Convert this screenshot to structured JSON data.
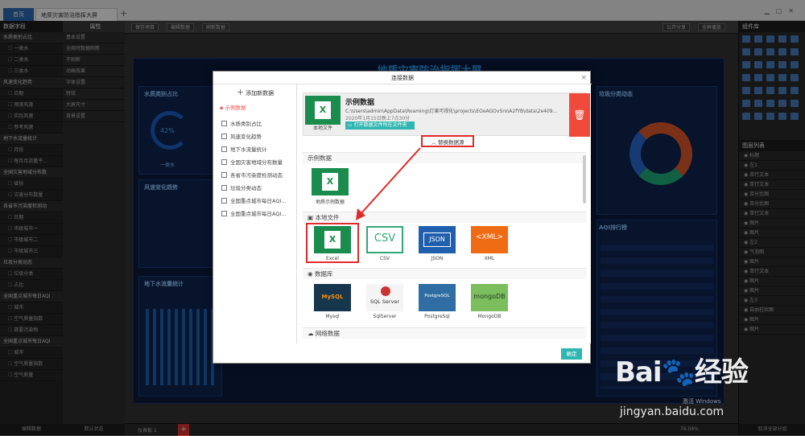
{
  "tabs": {
    "home": "首页",
    "project": "地质灾害防治指挥大屏",
    "add": "+"
  },
  "left": {
    "fields_title": "数据字段",
    "props_title": "属性",
    "groups": [
      {
        "name": "水质类别占比",
        "items": [
          "一类水",
          "二类水",
          "三类水"
        ]
      },
      {
        "name": "风速变化趋势",
        "items": [
          "日期",
          "预测风速",
          "实际风速",
          "参考风速"
        ]
      },
      {
        "name": "地下水流量统计",
        "items": [
          "月份",
          "每月月流量平..."
        ]
      },
      {
        "name": "全国灾害地域分布数",
        "items": [
          "省份",
          "灾害分布数量"
        ]
      },
      {
        "name": "各省市污染度检测动",
        "items": [
          "日期",
          "市级城市一",
          "市级城市二",
          "市级城市三"
        ]
      },
      {
        "name": "垃圾分类动态",
        "items": [
          "垃圾分类",
          "占比"
        ]
      },
      {
        "name": "全国重点城市每日AQI",
        "items": [
          "城市",
          "空气质量指数",
          "首要污染物"
        ]
      },
      {
        "name": "全国重点城市每日AQI",
        "items": [
          "城市",
          "空气质量指数",
          "空气质量"
        ]
      }
    ],
    "props": [
      "基本设置",
      "全局时数据刷新",
      "不刷新",
      "动画效果",
      "字体设置",
      "特效",
      "大屏尺寸",
      "背景设置"
    ],
    "footer_fields": "编辑数据",
    "footer_props": "默认状态"
  },
  "toolbar": {
    "save": "保存项目",
    "edit": "编辑数据",
    "refresh": "刷新数据",
    "share": "公开分享",
    "fullscreen": "全屏播放"
  },
  "dashboard": {
    "title": "地质灾害防治指挥大屏",
    "p1": "水质类别占比",
    "p1_value": "42%",
    "p1_label": "一类水",
    "p2": "风速变化趋势",
    "p3": "地下水流量统计",
    "p4": "垃圾分类动态",
    "p5": "AQI排行榜"
  },
  "status": {
    "page": "仪表板 1",
    "zoom": "76.04%"
  },
  "right": {
    "lib_title": "组件库",
    "layer_title": "图层列表",
    "layers": [
      "标题",
      "左1",
      "单行文本",
      "单行文本",
      "百分比图",
      "百分比图",
      "单行文本",
      "图片",
      "图片",
      "左2",
      "气泡图",
      "图片",
      "单行文本",
      "图片",
      "图片",
      "左3",
      "自由柱状图",
      "图片",
      "图片"
    ],
    "footer": "取消全部分组"
  },
  "modal": {
    "title": "连接数据",
    "close": "×",
    "add_data": "添加新数据",
    "root": "示例数据",
    "tables": [
      "水质类别占比",
      "风速变化趋势",
      "地下水流量统计",
      "全国灾害地域分布数量",
      "各省市污染度检测动态",
      "垃圾分类动态",
      "全国重点城市每日AQI...",
      "全国重点城市每日AQI..."
    ],
    "current": {
      "title": "示例数据",
      "path": "C:\\Users\\admin\\AppData\\Roaming\\灯果可视化\\projects\\EOeAGOvSro\\A2fYB\\data\\2e409b7...",
      "date": "2020年1月15日晚上7点30分",
      "type": "本地文件",
      "open_folder": "打开数据文件所在文件夹"
    },
    "switch_source": "替换数据源",
    "sections": {
      "sample": "示例数据",
      "local": "本地文件",
      "db": "数据库",
      "net": "网络数据"
    },
    "sample_tiles": [
      "地质示例数据"
    ],
    "local_tiles": [
      "Excel",
      "CSV",
      "JSON",
      "XML"
    ],
    "db_tiles": [
      "Mysql",
      "SqlServer",
      "PostgreSql",
      "MongoDB"
    ],
    "tile_art": {
      "csv": "CSV",
      "json": "JSON",
      "xml": "<XML>",
      "mysql": "MySQL",
      "sqlserver": "SQL Server",
      "postgres": "PostgreSQL",
      "mongo": "mongoDB"
    },
    "confirm": "确定"
  },
  "watermark": {
    "logo": "Bai",
    "logo2": "经验",
    "url": "jingyan.baidu.com",
    "win": "激活 Windows"
  },
  "colors": {
    "accent": "#2fb6b0",
    "danger": "#ee4b3c",
    "highlight": "#e02b2b",
    "excel": "#1a8c4e"
  }
}
